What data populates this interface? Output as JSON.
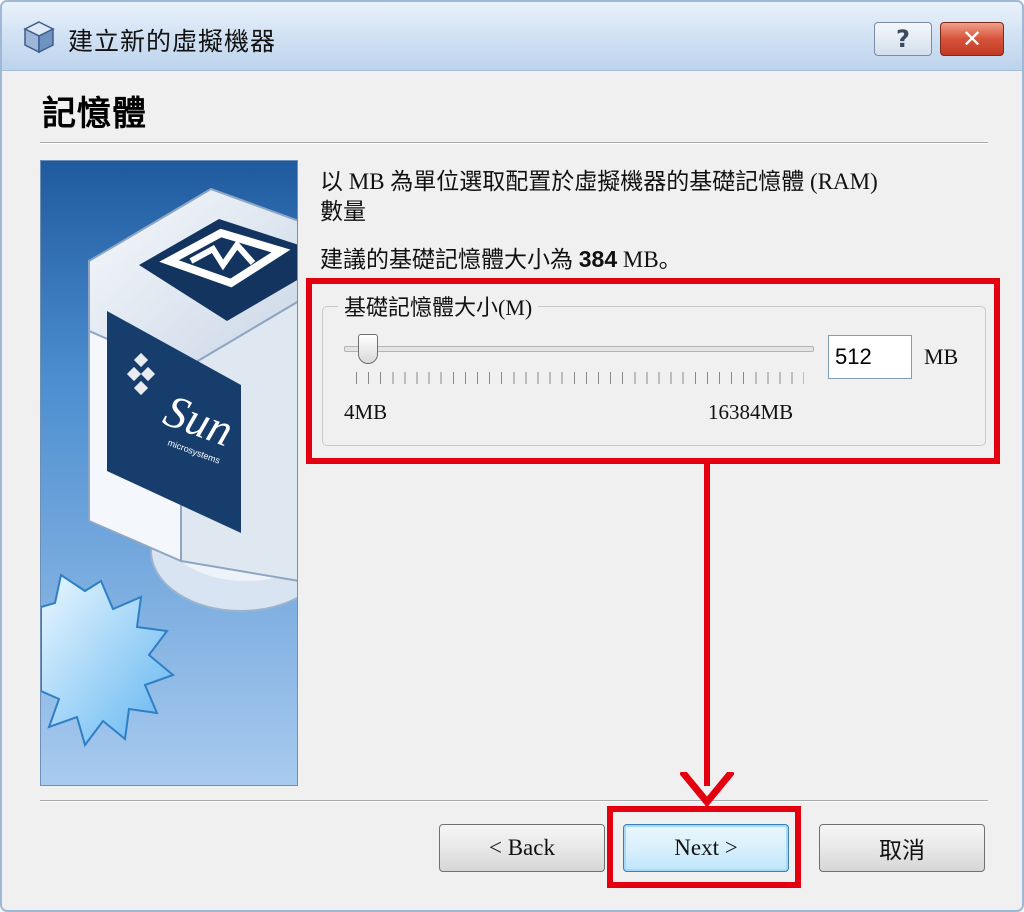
{
  "window": {
    "title": "建立新的虛擬機器",
    "help_label": "?",
    "close_label": "✕",
    "icon": "virtualbox-cube-icon"
  },
  "page": {
    "heading": "記憶體",
    "description_line1": "以 MB 為單位選取配置於虛擬機器的基礎記憶體 (RAM)",
    "description_line2": "數量",
    "recommend_prefix": "建議的基礎記憶體大小為 ",
    "recommend_value": "384",
    "recommend_suffix": " MB。"
  },
  "memory": {
    "group_label": "基礎記憶體大小(M)",
    "value": "512",
    "unit": "MB",
    "min_label": "4MB",
    "max_label": "16384MB",
    "min_mb": 4,
    "max_mb": 16384,
    "current_mb": 512
  },
  "buttons": {
    "back": "< Back",
    "next": "Next >",
    "cancel": "取消"
  },
  "colors": {
    "highlight": "#e3000f",
    "titlebar": "#cfe0f3"
  }
}
